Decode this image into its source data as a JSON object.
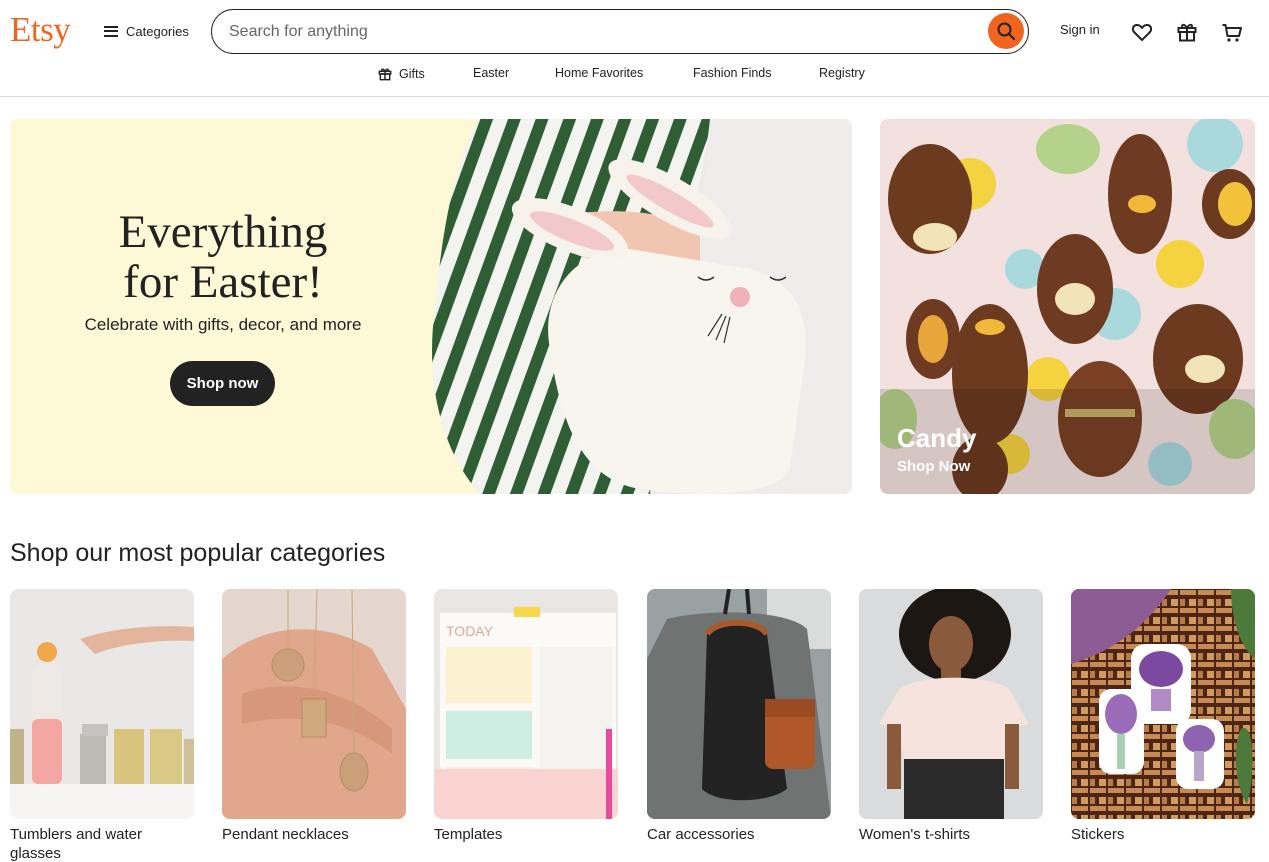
{
  "header": {
    "logo": "Etsy",
    "categories_label": "Categories",
    "search_placeholder": "Search for anything",
    "signin_label": "Sign in",
    "accent_color": "#f1641e"
  },
  "subnav": {
    "items": [
      {
        "label": "Gifts",
        "icon": "gift-icon"
      },
      {
        "label": "Easter"
      },
      {
        "label": "Home Favorites"
      },
      {
        "label": "Fashion Finds"
      },
      {
        "label": "Registry"
      }
    ]
  },
  "hero": {
    "title_line1": "Everything",
    "title_line2": "for Easter!",
    "subtitle": "Celebrate with gifts, decor, and more",
    "button": "Shop now"
  },
  "promo": {
    "title": "Candy",
    "link": "Shop Now"
  },
  "popular": {
    "title": "Shop our most popular categories",
    "items": [
      {
        "label": "Tumblers and water glasses"
      },
      {
        "label": "Pendant necklaces"
      },
      {
        "label": "Templates"
      },
      {
        "label": "Car accessories"
      },
      {
        "label": "Women's t-shirts"
      },
      {
        "label": "Stickers"
      }
    ]
  }
}
